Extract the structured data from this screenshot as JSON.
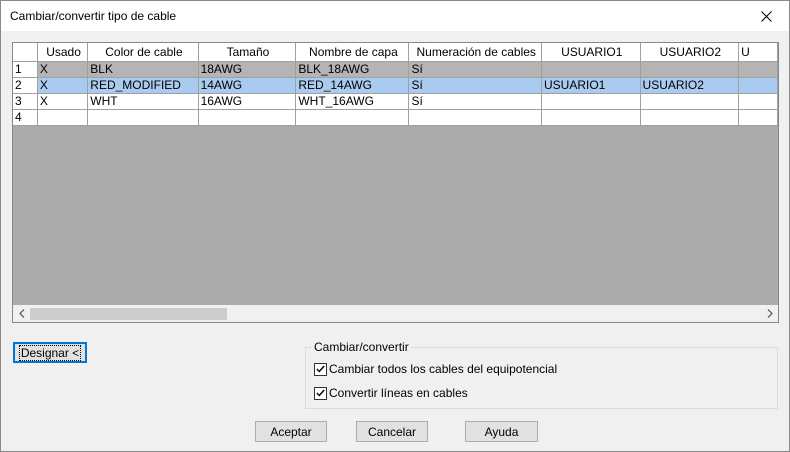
{
  "window": {
    "title": "Cambiar/convertir tipo de cable",
    "close_icon": "close-icon"
  },
  "grid": {
    "columns": [
      "Usado",
      "Color de cable",
      "Tamaño",
      "Nombre de capa",
      "Numeración de cables",
      "USUARIO1",
      "USUARIO2",
      "U"
    ],
    "rows": [
      {
        "num": "1",
        "cells": [
          "X",
          "BLK",
          "18AWG",
          "BLK_18AWG",
          "Sí",
          "",
          "",
          ""
        ],
        "state": "gray"
      },
      {
        "num": "2",
        "cells": [
          "X",
          "RED_MODIFIED",
          "14AWG",
          "RED_14AWG",
          "Sí",
          "USUARIO1",
          "USUARIO2",
          ""
        ],
        "state": "selected"
      },
      {
        "num": "3",
        "cells": [
          "X",
          "WHT",
          "16AWG",
          "WHT_16AWG",
          "Sí",
          "",
          "",
          ""
        ],
        "state": "normal"
      },
      {
        "num": "4",
        "cells": [
          "",
          "",
          "",
          "",
          "",
          "",
          "",
          ""
        ],
        "state": "normal"
      }
    ]
  },
  "buttons": {
    "designar": "Designar <",
    "aceptar": "Aceptar",
    "cancelar": "Cancelar",
    "ayuda": "Ayuda"
  },
  "group": {
    "title": "Cambiar/convertir",
    "options": [
      {
        "label": "Cambiar todos los cables del equipotencial",
        "checked": true
      },
      {
        "label": "Convertir líneas en cables",
        "checked": true
      }
    ]
  },
  "colors": {
    "selected_row": "#aacbf0",
    "gray_row": "#b4b4b4",
    "grid_background": "#ababab",
    "dialog_background": "#f0f0f0"
  }
}
